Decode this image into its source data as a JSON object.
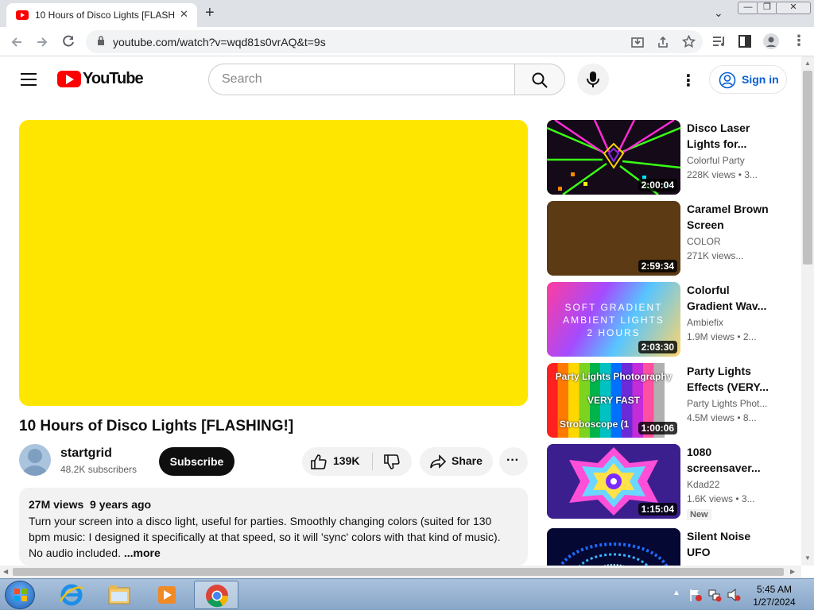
{
  "browser": {
    "tab_title": "10 Hours of Disco Lights [FLASHI",
    "tab_close": "✕",
    "new_tab": "+",
    "url": "youtube.com/watch?v=wqd81s0vrAQ&t=9s",
    "win_min": "—",
    "win_max": "❐",
    "win_close": "✕",
    "dropdown": "⌄"
  },
  "youtube": {
    "logo_text": "YouTube",
    "search_placeholder": "Search",
    "kebab": "⋮",
    "signin_label": "Sign in"
  },
  "video": {
    "title": "10 Hours of Disco Lights [FLASHING!]",
    "player_color": "#FFE600",
    "channel": "startgrid",
    "subscribers": "48.2K subscribers",
    "subscribe_label": "Subscribe",
    "likes": "139K",
    "share_label": "Share",
    "more_actions": "···",
    "views": "27M views",
    "age": "9 years ago",
    "description": "Turn your screen into a disco light, useful for parties. Smoothly changing colors (suited for 130 bpm music: I designed it specifically at that speed, so it will 'sync' colors with that kind of music). No audio included.",
    "more_label": "...more"
  },
  "recommendations": [
    {
      "title": "Disco Laser Lights for...",
      "channel": "Colorful Party",
      "views": "228K views  • 3...",
      "duration": "2:00:04",
      "thumb_icon": "disco-laser-thumbnail"
    },
    {
      "title": "Caramel Brown Screen",
      "channel": "COLOR",
      "views": "271K views...",
      "duration": "2:59:34",
      "thumb_icon": "brown-screen-thumbnail"
    },
    {
      "title": "Colorful Gradient Wav...",
      "channel": "Ambiefix",
      "views": "1.9M views  • 2...",
      "duration": "2:03:30",
      "thumb_icon": "gradient-thumbnail",
      "thumb_text": [
        "SOFT GRADIENT",
        "AMBIENT LIGHTS",
        "2 HOURS"
      ]
    },
    {
      "title": "Party Lights Effects (VERY...",
      "channel": "Party Lights Phot...",
      "views": "4.5M views  • 8...",
      "duration": "1:00:06",
      "thumb_icon": "party-lights-thumbnail",
      "thumb_text": [
        "Party Lights Photography",
        "VERY FAST",
        "Stroboscope (1"
      ]
    },
    {
      "title": "1080 screensaver...",
      "channel": "Kdad22",
      "views": "1.6K views  • 3...",
      "duration": "1:15:04",
      "badge": "New",
      "thumb_icon": "kaleidoscope-thumbnail"
    },
    {
      "title": "Silent Noise UFO",
      "thumb_icon": "ufo-tunnel-thumbnail"
    }
  ],
  "taskbar": {
    "time": "5:45 AM",
    "date": "1/27/2024"
  }
}
